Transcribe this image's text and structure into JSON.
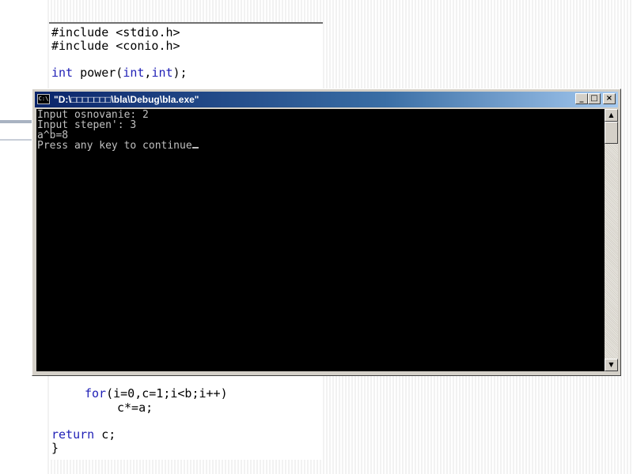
{
  "code_top": {
    "line1": "#include <stdio.h>",
    "line2": "#include <conio.h>",
    "line3_kw": "int",
    "line3_mid": " power(",
    "line3_kw2": "int",
    "line3_comma": ",",
    "line3_kw3": "int",
    "line3_end": ");"
  },
  "code_bottom": {
    "for_kw": "for",
    "for_rest": "(i=0,c=1;i<b;i++)",
    "body": "c*=a;",
    "return_kw": "return",
    "return_rest": " c;",
    "close_brace": "}"
  },
  "console": {
    "title": "\"D:\\□□□□□□□\\bla\\Debug\\bla.exe\"",
    "icon_text": "C:\\",
    "lines": [
      "Input osnovanie: 2",
      "Input stepen': 3",
      "a^b=8",
      "Press any key to continue"
    ],
    "buttons": {
      "minimize": "_",
      "maximize": "□",
      "close": "×"
    },
    "scroll_up": "▲",
    "scroll_down": "▼"
  },
  "icons": {
    "app": "console-app-icon",
    "minimize": "minimize-icon",
    "maximize": "maximize-icon",
    "close": "close-icon"
  },
  "colors": {
    "title_bar_start": "#0a246a",
    "title_bar_end": "#a6caf0",
    "console_bg": "#000000",
    "console_text": "#c0c0c0",
    "keyword": "#1f1fb6"
  }
}
